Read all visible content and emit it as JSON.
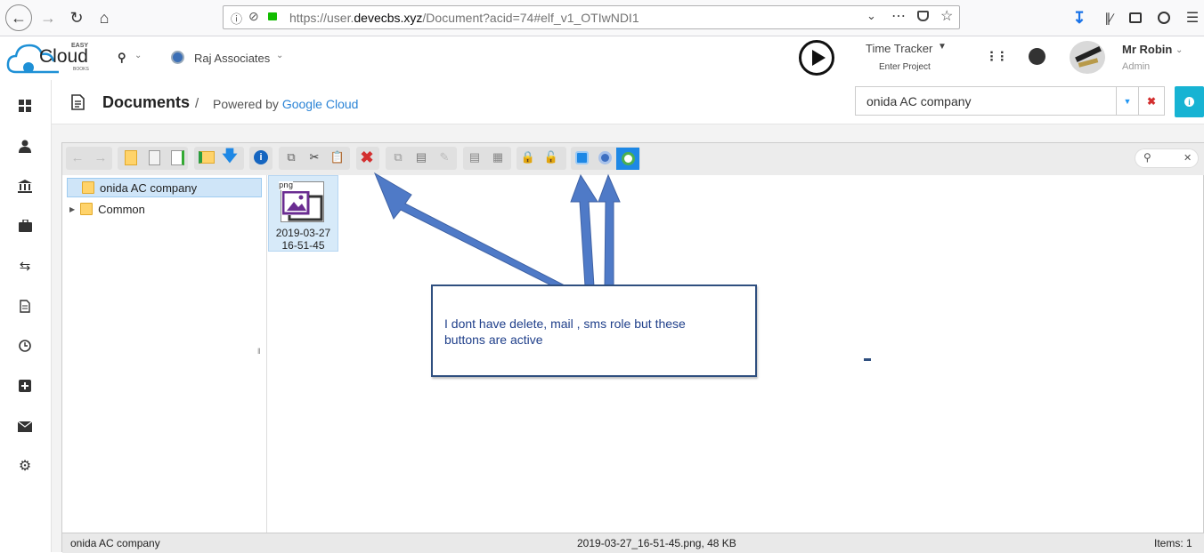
{
  "browser": {
    "url_prefix": "https://user.",
    "url_domain": "devecbs.xyz",
    "url_path": "/Document?acid=74#elf_v1_OTIwNDI1"
  },
  "header": {
    "logo_top": "EASY",
    "logo_main": "Cloud",
    "logo_sub": "BOOKS",
    "company": "Raj Associates",
    "time_tracker": "Time Tracker",
    "enter_project": "Enter Project",
    "user_name": "Mr Robin",
    "user_role": "Admin"
  },
  "title_bar": {
    "title": "Documents",
    "separator": "/",
    "powered_by": "Powered by",
    "provider": "Google Cloud",
    "selected_company": "onida AC company"
  },
  "tree": {
    "items": [
      {
        "label": "onida AC company"
      },
      {
        "label": "Common"
      }
    ]
  },
  "file": {
    "ext": "png",
    "name_line1": "2019-03-27",
    "name_line2": "16-51-45"
  },
  "annotation": {
    "text": "I dont have delete, mail , sms role but these buttons are active"
  },
  "status": {
    "left": "onida AC company",
    "center": "2019-03-27_16-51-45.png, 48 KB",
    "right": "Items: 1"
  },
  "colors": {
    "accent": "#2196F3",
    "link": "#2b84d6",
    "callout_border": "#2f4f7f",
    "arrow": "#4f7ac7",
    "delete": "#d32f2f",
    "info_btn": "#17b3d3"
  }
}
